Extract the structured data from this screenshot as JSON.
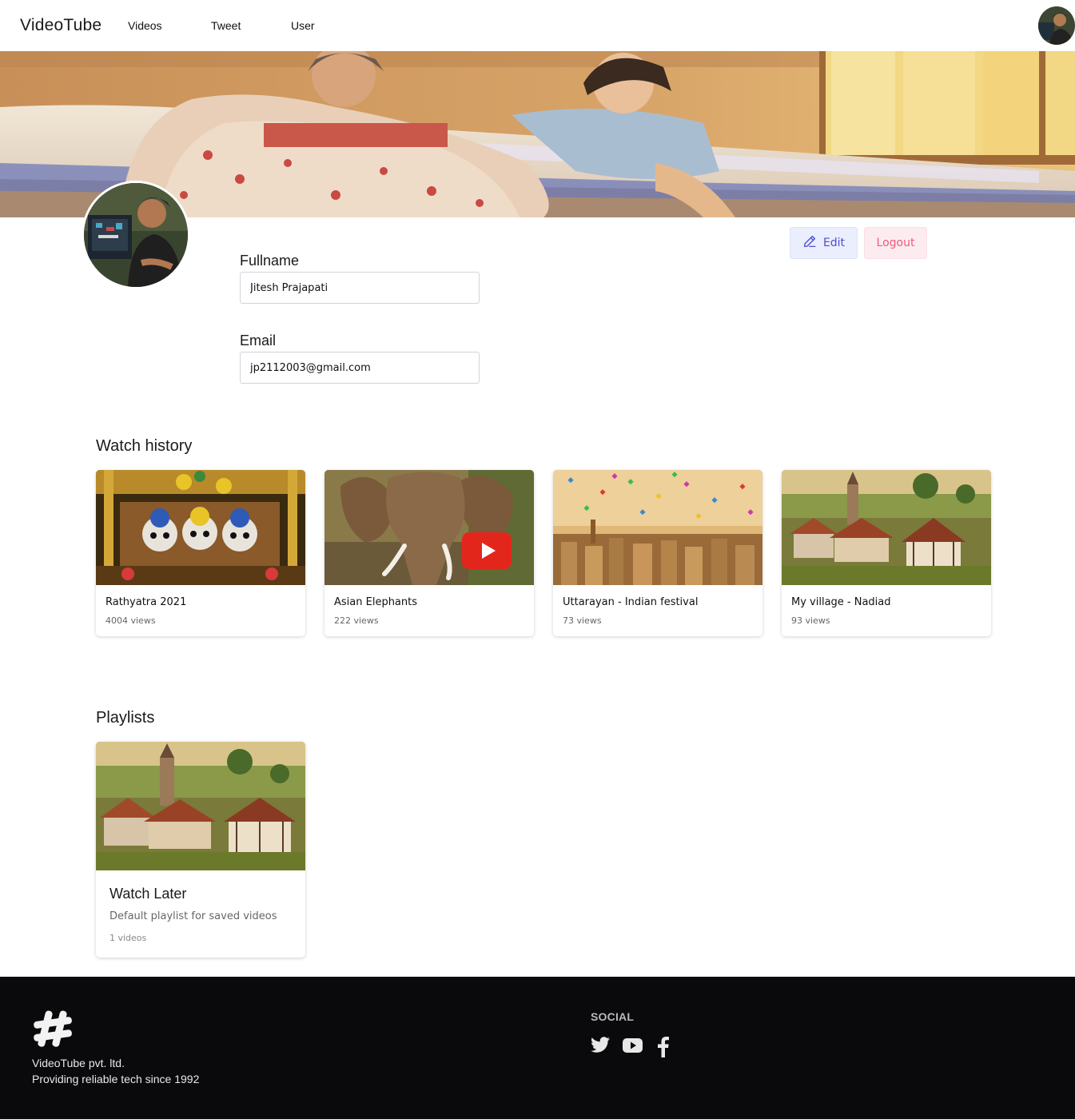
{
  "nav": {
    "brand": "VideoTube",
    "links": [
      "Videos",
      "Tweet",
      "User"
    ]
  },
  "profile": {
    "fullname_label": "Fullname",
    "fullname_value": "Jitesh Prajapati",
    "email_label": "Email",
    "email_value": "jp2112003@gmail.com",
    "edit_label": "Edit",
    "logout_label": "Logout"
  },
  "watch_history": {
    "title": "Watch history",
    "videos": [
      {
        "title": "Rathyatra 2021",
        "views": "4004 views"
      },
      {
        "title": "Asian Elephants",
        "views": "222 views"
      },
      {
        "title": "Uttarayan - Indian festival",
        "views": "73 views"
      },
      {
        "title": "My village - Nadiad",
        "views": "93 views"
      }
    ]
  },
  "playlists": {
    "title": "Playlists",
    "items": [
      {
        "title": "Watch Later",
        "description": "Default playlist for saved videos",
        "count": "1 videos"
      }
    ]
  },
  "footer": {
    "company": "VideoTube pvt. ltd.",
    "tagline": "Providing reliable tech since 1992",
    "social_title": "SOCIAL",
    "social_icons": [
      "twitter-icon",
      "youtube-icon",
      "facebook-icon"
    ]
  },
  "colors": {
    "edit_text": "#4b4fd1",
    "edit_bg": "#eaeefd",
    "logout_text": "#ef5a7b",
    "logout_bg": "#fdecef",
    "footer_bg": "#0a0a0d"
  }
}
